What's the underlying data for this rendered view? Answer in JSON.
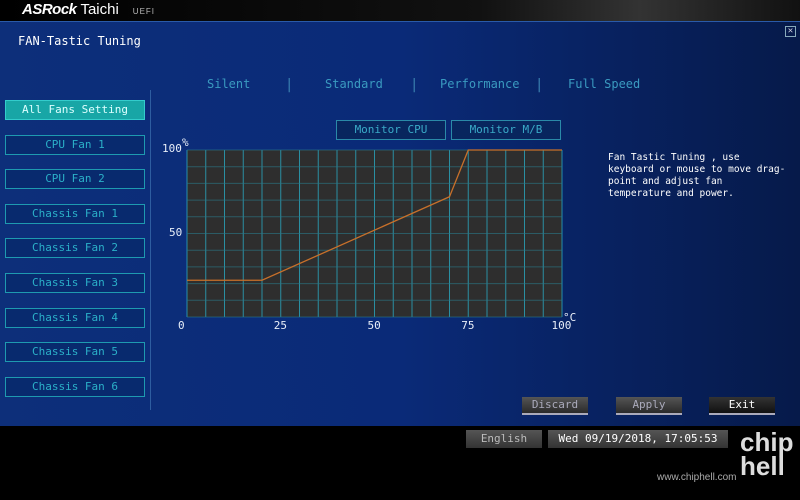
{
  "header": {
    "brand": "ASRock",
    "model": "Taichi",
    "uefi": "UEFI"
  },
  "page_title": "FAN-Tastic Tuning",
  "fans": [
    "All Fans Setting",
    "CPU Fan 1",
    "CPU Fan 2",
    "Chassis Fan 1",
    "Chassis Fan 2",
    "Chassis Fan 3",
    "Chassis Fan 4",
    "Chassis Fan 5",
    "Chassis Fan 6"
  ],
  "modes": [
    "Silent",
    "Standard",
    "Performance",
    "Full Speed"
  ],
  "monitor": {
    "cpu": "Monitor CPU",
    "mb": "Monitor M/B"
  },
  "help": "Fan Tastic Tuning , use keyboard or mouse to move drag-point and adjust fan temperature and power.",
  "buttons": {
    "discard": "Discard",
    "apply": "Apply",
    "exit": "Exit"
  },
  "footer": {
    "language": "English",
    "datetime": "Wed 09/19/2018, 17:05:53",
    "watermark": "www.chiphell.com",
    "watermark_logo": "chip hell"
  },
  "chart_data": {
    "type": "line",
    "xlabel": "°C",
    "ylabel": "%",
    "xlim": [
      0,
      100
    ],
    "ylim": [
      0,
      100
    ],
    "xticks": [
      "0",
      "25",
      "50",
      "75",
      "100"
    ],
    "yticks": [
      "50",
      "100"
    ],
    "series": [
      {
        "name": "fan curve",
        "color": "#c8702a",
        "x": [
          0,
          20,
          70,
          75,
          100
        ],
        "y": [
          22,
          22,
          72,
          100,
          100
        ]
      }
    ]
  }
}
